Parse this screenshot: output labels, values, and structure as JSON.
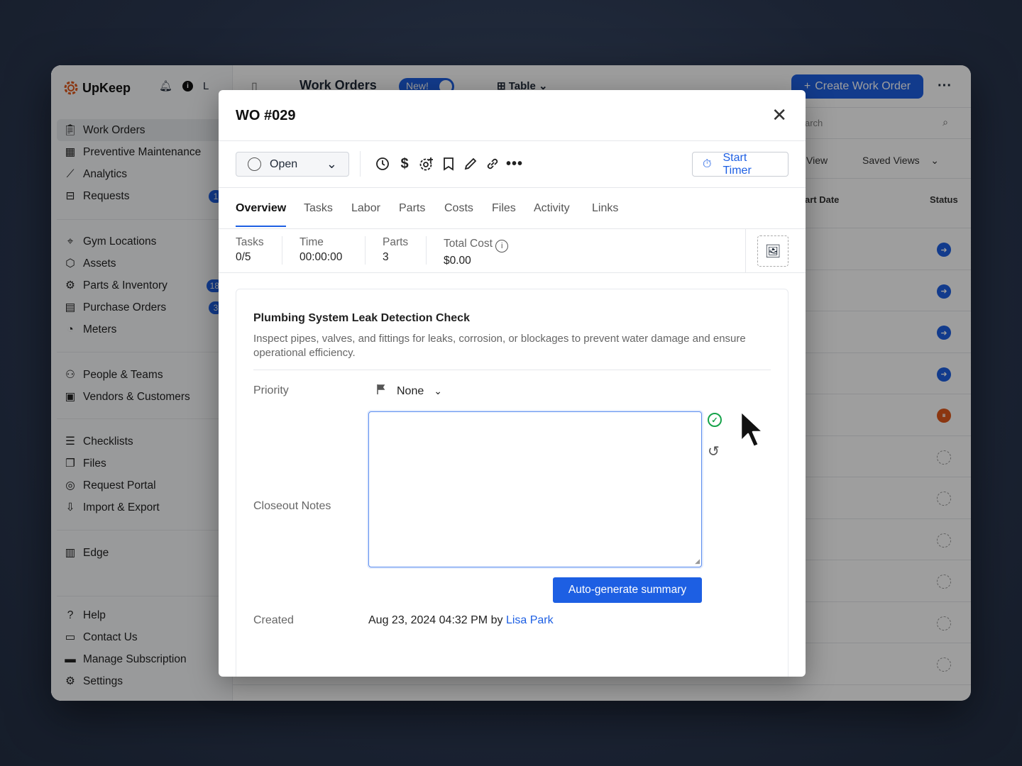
{
  "brand": {
    "name": "UpKeep",
    "accent": "#1d5fe3",
    "avatar_initial": "L"
  },
  "sidebar": {
    "group1": [
      {
        "label": "Work Orders",
        "icon": "clipboard-icon",
        "active": true
      },
      {
        "label": "Preventive Maintenance",
        "icon": "calendar-icon"
      },
      {
        "label": "Analytics",
        "icon": "chart-icon"
      },
      {
        "label": "Requests",
        "icon": "inbox-icon",
        "badge": "1"
      }
    ],
    "group2": [
      {
        "label": "Gym Locations",
        "icon": "location-icon"
      },
      {
        "label": "Assets",
        "icon": "cube-icon"
      },
      {
        "label": "Parts & Inventory",
        "icon": "parts-icon",
        "badge": "18"
      },
      {
        "label": "Purchase Orders",
        "icon": "document-icon",
        "badge": "3"
      },
      {
        "label": "Meters",
        "icon": "gauge-icon"
      }
    ],
    "group3": [
      {
        "label": "People & Teams",
        "icon": "people-icon"
      },
      {
        "label": "Vendors & Customers",
        "icon": "contact-icon"
      }
    ],
    "group4": [
      {
        "label": "Checklists",
        "icon": "checklist-icon"
      },
      {
        "label": "Files",
        "icon": "files-icon"
      },
      {
        "label": "Request Portal",
        "icon": "portal-icon"
      },
      {
        "label": "Import & Export",
        "icon": "import-icon"
      }
    ],
    "group5": [
      {
        "label": "Edge",
        "icon": "edge-icon"
      }
    ],
    "group6": [
      {
        "label": "Help",
        "icon": "help-icon"
      },
      {
        "label": "Contact Us",
        "icon": "chat-icon"
      },
      {
        "label": "Manage Subscription",
        "icon": "card-icon"
      },
      {
        "label": "Settings",
        "icon": "gear-icon"
      }
    ]
  },
  "header": {
    "title": "Work Orders",
    "new_toggle": "New!",
    "view_mode": "Table",
    "create_button": "Create Work Order",
    "search_placeholder_fragment": "arch",
    "view_fragment": "View",
    "saved_views": "Saved Views",
    "col_start_date": "art Date",
    "col_status": "Status"
  },
  "table_status": [
    "blue",
    "blue",
    "blue",
    "blue",
    "orange",
    "dash",
    "dash",
    "dash",
    "dash",
    "dash",
    "dash"
  ],
  "modal": {
    "title": "WO #029",
    "status": "Open",
    "start_timer": "Start Timer",
    "tabs": [
      "Overview",
      "Tasks",
      "Labor",
      "Parts",
      "Costs",
      "Files",
      "Activity",
      "Links"
    ],
    "stats": {
      "tasks_label": "Tasks",
      "tasks_value": "0/5",
      "time_label": "Time",
      "time_value": "00:00:00",
      "parts_label": "Parts",
      "parts_value": "3",
      "cost_label": "Total Cost",
      "cost_value": "$0.00"
    },
    "card": {
      "title": "Plumbing System Leak Detection Check",
      "description": "Inspect pipes, valves, and fittings for leaks, corrosion, or blockages to prevent water damage and ensure operational efficiency.",
      "priority_label": "Priority",
      "priority_value": "None",
      "closeout_label": "Closeout Notes",
      "closeout_value": "",
      "auto_button": "Auto-generate summary",
      "created_label": "Created",
      "created_value": "Aug 23, 2024 04:32 PM",
      "created_by": "by",
      "created_user": "Lisa Park"
    }
  }
}
